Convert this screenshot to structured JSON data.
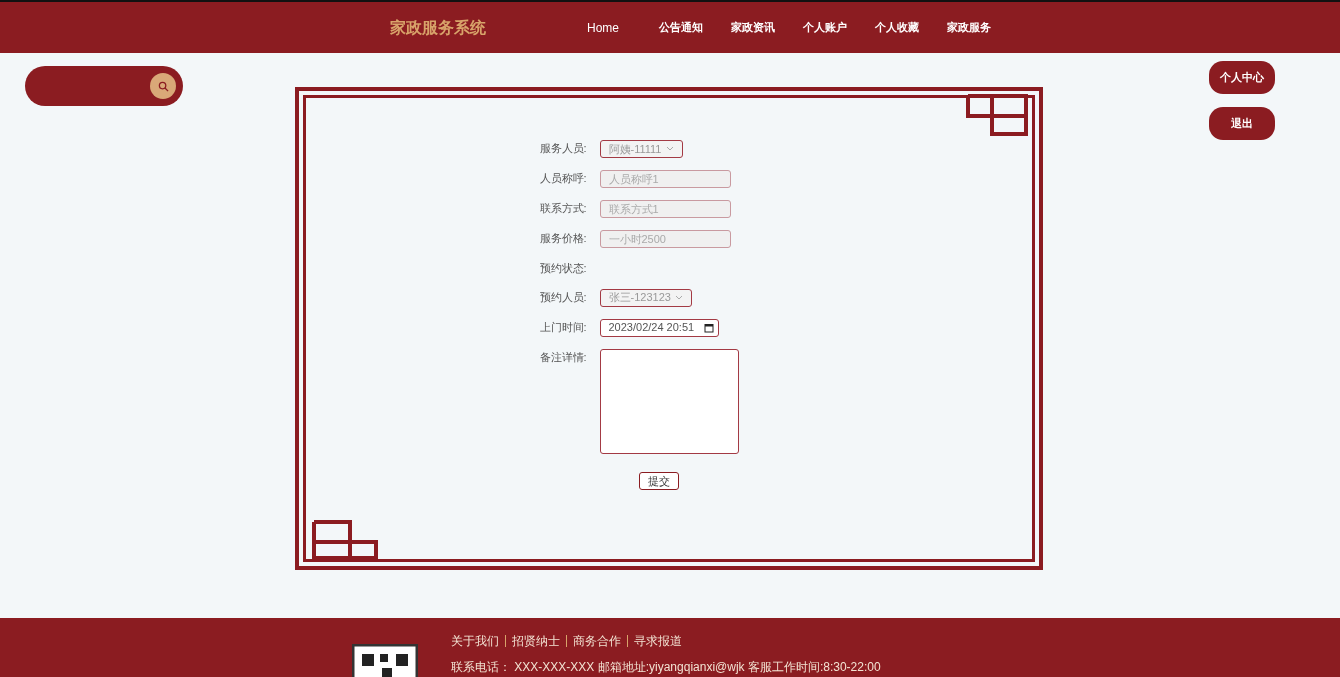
{
  "header": {
    "title": "家政服务系统",
    "nav": [
      {
        "label": "Home",
        "selected": true
      },
      {
        "label": "公告通知",
        "selected": false
      },
      {
        "label": "家政资讯",
        "selected": false
      },
      {
        "label": "个人账户",
        "selected": false
      },
      {
        "label": "个人收藏",
        "selected": false
      },
      {
        "label": "家政服务",
        "selected": false
      }
    ]
  },
  "side_buttons": [
    "个人中心",
    "退出"
  ],
  "form": {
    "fields": [
      {
        "kind": "select",
        "label": "服务人员:",
        "value": "阿姨-11111"
      },
      {
        "kind": "input",
        "label": "人员称呼:",
        "value": "人员称呼1",
        "disabled": true
      },
      {
        "kind": "input",
        "label": "联系方式:",
        "value": "联系方式1",
        "disabled": true
      },
      {
        "kind": "input",
        "label": "服务价格:",
        "value": "一小时2500",
        "disabled": true
      },
      {
        "kind": "text",
        "label": "预约状态:"
      },
      {
        "kind": "select",
        "label": "预约人员:",
        "value": "张三-123123"
      },
      {
        "kind": "datetime",
        "label": "上门时间:",
        "value": "2023/02/24 20:51"
      },
      {
        "kind": "textarea",
        "label": "备注详情:"
      }
    ],
    "submit": "提交"
  },
  "footer": {
    "links": [
      "关于我们",
      "招贤纳士",
      "商务合作",
      "寻求报道"
    ],
    "contact": "联系电话： XXX-XXX-XXX 邮箱地址:yiyangqianxi@wjk 客服工作时间:8:30-22:00"
  }
}
